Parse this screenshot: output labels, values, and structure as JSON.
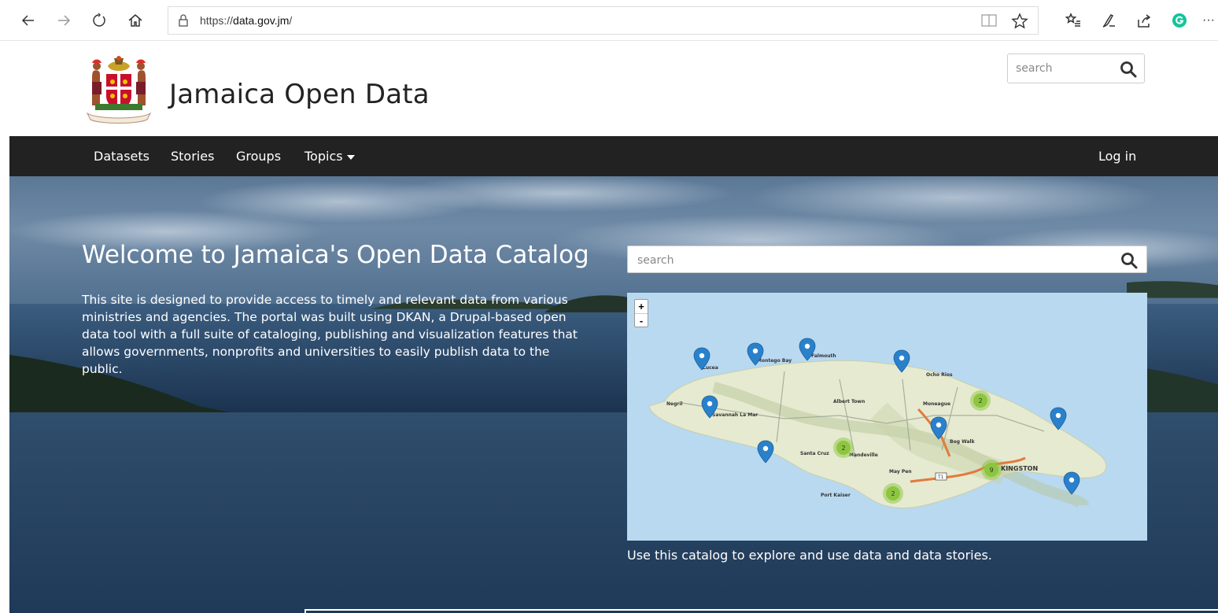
{
  "browser": {
    "url_prefix": "https://",
    "url_host": "data.gov.jm",
    "url_path": "/",
    "more_label": "···"
  },
  "site": {
    "title": "Jamaica Open Data",
    "search_placeholder": "search"
  },
  "nav": {
    "items": [
      {
        "label": "Datasets"
      },
      {
        "label": "Stories"
      },
      {
        "label": "Groups"
      },
      {
        "label": "Topics"
      }
    ],
    "login_label": "Log in"
  },
  "hero": {
    "title": "Welcome to Jamaica's Open Data Catalog",
    "description": "This site is designed to provide access to timely and relevant data from various ministries and agencies. The portal was built using DKAN, a Drupal-based open data tool with a full suite of cataloging, publishing and visualization features that allows governments, nonprofits and universities to easily publish data to the public.",
    "search_placeholder": "search",
    "map_caption": "Use this catalog to explore and use data and data stories."
  },
  "map": {
    "zoom_in": "+",
    "zoom_out": "-",
    "places": [
      "Lucea",
      "Montego Bay",
      "Falmouth",
      "Ocho Rios",
      "Negril",
      "Savannah La Mar",
      "Albert Town",
      "Moneague",
      "Bog Walk",
      "Santa Cruz",
      "Mandeville",
      "May Pen",
      "Port Kaiser",
      "KINGSTON"
    ],
    "clusters": [
      "2",
      "2",
      "2",
      "9"
    ],
    "road_label": "T1"
  },
  "colors": {
    "navbar": "#222222",
    "marker": "#2a81cb",
    "cluster": "#8cc63f"
  }
}
